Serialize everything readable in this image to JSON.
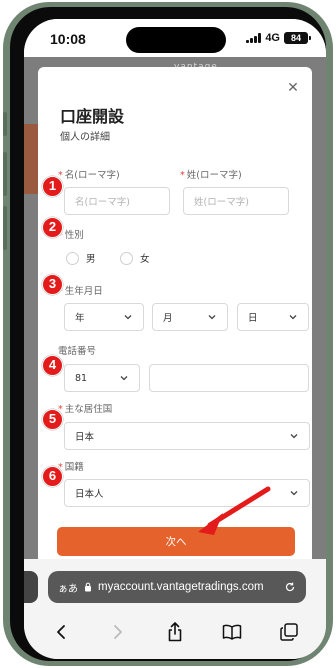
{
  "status_bar": {
    "time": "10:08",
    "network": "4G",
    "battery": "84"
  },
  "background": {
    "brand_text": "vantage"
  },
  "modal": {
    "title": "口座開設",
    "subtitle": "個人の詳細",
    "close_icon": "close-icon",
    "fields": {
      "first_name": {
        "label": "名(ローマ字)",
        "placeholder": "名(ローマ字)",
        "required": true
      },
      "last_name": {
        "label": "姓(ローマ字)",
        "placeholder": "姓(ローマ字)",
        "required": true
      },
      "gender": {
        "label": "性別",
        "required": true,
        "options": [
          "男",
          "女"
        ]
      },
      "birth_date": {
        "label": "生年月日",
        "required": true,
        "year": "年",
        "month": "月",
        "day": "日"
      },
      "phone": {
        "label": "電話番号",
        "required": false,
        "country_code": "81",
        "value": ""
      },
      "residence": {
        "label": "主な居住国",
        "required": true,
        "value": "日本"
      },
      "nationality": {
        "label": "国籍",
        "required": true,
        "value": "日本人"
      }
    },
    "next_button": "次へ"
  },
  "annotations": {
    "markers": [
      "1",
      "2",
      "3",
      "4",
      "5",
      "6"
    ],
    "marker_color": "#e41b1b",
    "arrow_color": "#e41b1b"
  },
  "browser": {
    "aa_label": "ぁあ",
    "url": "myaccount.vantagetradings.com"
  },
  "colors": {
    "accent": "#e6622d",
    "required": "#e0463b"
  }
}
